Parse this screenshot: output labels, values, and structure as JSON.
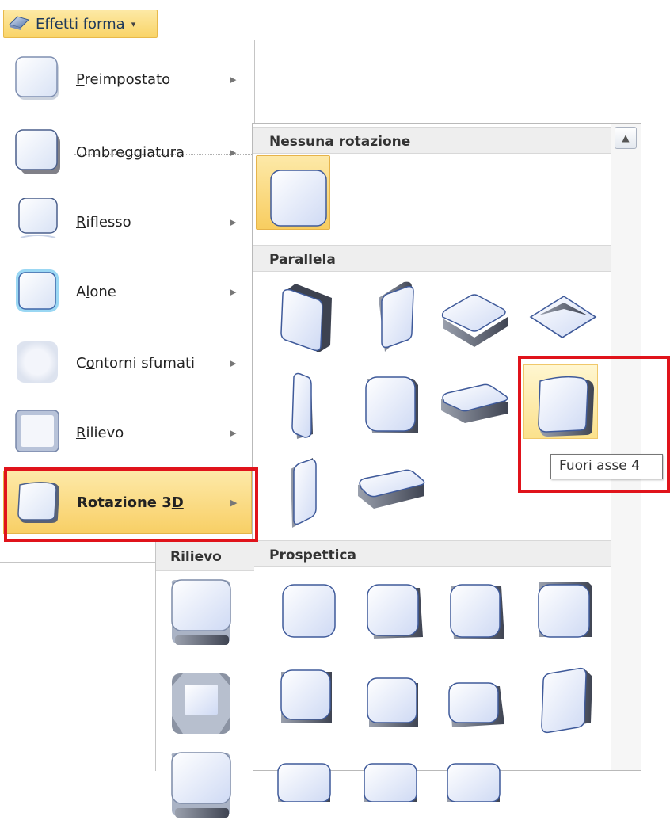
{
  "ribbon": {
    "button_label": "Effetti forma",
    "icon": "shape-effects-icon",
    "dropdown_icon": "dropdown-arrow-icon"
  },
  "menu": {
    "items": [
      {
        "pre": "",
        "key": "P",
        "post": "reimpostato",
        "icon": "preset-icon"
      },
      {
        "pre": "Om",
        "key": "b",
        "post": "reggiatura",
        "icon": "shadow-icon"
      },
      {
        "pre": "",
        "key": "R",
        "post": "iflesso",
        "icon": "reflection-icon"
      },
      {
        "pre": "A",
        "key": "l",
        "post": "one",
        "icon": "glow-icon"
      },
      {
        "pre": "C",
        "key": "o",
        "post": "ntorni sfumati",
        "icon": "soft-edges-icon"
      },
      {
        "pre": "",
        "key": "R",
        "post": "ilievo",
        "icon": "bevel-icon"
      },
      {
        "pre": "Rotazione 3",
        "key": "D",
        "post": "",
        "icon": "3d-rotation-icon"
      }
    ],
    "active_index": 6,
    "submenu_arrow": "▶"
  },
  "submenu": {
    "sections": {
      "none": "Nessuna rotazione",
      "parallel": "Parallela",
      "perspective": "Prospettica"
    },
    "scroll_up": "▲"
  },
  "bevel_column": {
    "header": "Rilievo"
  },
  "tooltip": {
    "text": "Fuori asse 4"
  },
  "colors": {
    "highlight_red": "#e0131b",
    "selection": "#f8cf65",
    "shape_fill": "#e6ecfb",
    "shape_stroke": "#5a6a9a"
  }
}
